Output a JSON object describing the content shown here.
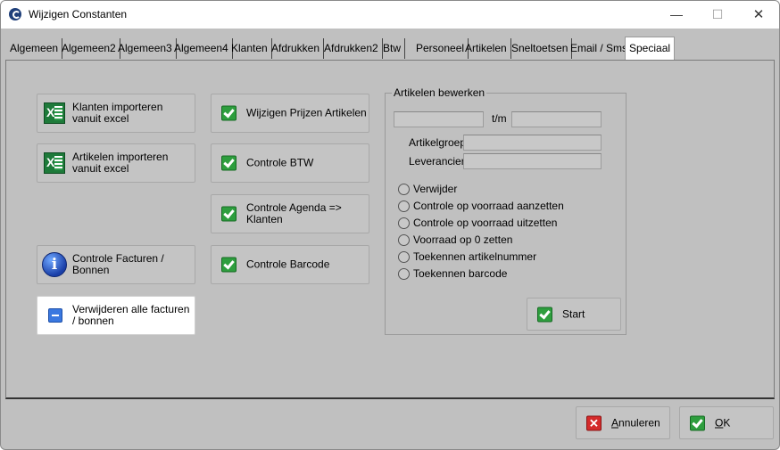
{
  "window": {
    "title": "Wijzigen Constanten"
  },
  "titlebar": {
    "minimize": "—",
    "maximize": "☐",
    "close": "✕"
  },
  "tabs": [
    {
      "label": "Algemeen"
    },
    {
      "label": "Algemeen2"
    },
    {
      "label": "Algemeen3"
    },
    {
      "label": "Algemeen4"
    },
    {
      "label": "Klanten"
    },
    {
      "label": "Afdrukken"
    },
    {
      "label": "Afdrukken2"
    },
    {
      "label": "Btw"
    },
    {
      "label": "Personeel"
    },
    {
      "label": "Artikelen"
    },
    {
      "label": "Sneltoetsen"
    },
    {
      "label": "Email / Sms"
    },
    {
      "label": "Speciaal"
    }
  ],
  "active_tab": "Speciaal",
  "left_buttons": {
    "import_klanten": "Klanten importeren vanuit excel",
    "import_artikelen": "Artikelen importeren vanuit excel",
    "controle_facturen": "Controle Facturen / Bonnen",
    "verwijderen_facturen": "Verwijderen alle facturen / bonnen"
  },
  "middle_buttons": {
    "wijzigen_prijzen": "Wijzigen Prijzen Artikelen",
    "controle_btw": "Controle BTW",
    "controle_agenda": "Controle Agenda => Klanten",
    "controle_barcode": "Controle Barcode"
  },
  "artikelen_bewerken": {
    "title": "Artikelen bewerken",
    "range_from": "",
    "range_sep": "t/m",
    "range_to": "",
    "artikelgroep_label": "Artikelgroep",
    "artikelgroep_value": "",
    "leverancier_label": "Leverancier",
    "leverancier_value": "",
    "options": [
      "Verwijder",
      "Controle op voorraad aanzetten",
      "Controle op voorraad uitzetten",
      "Voorraad op 0 zetten",
      "Toekennen artikelnummer",
      "Toekennen barcode"
    ],
    "start_label": "Start"
  },
  "footer": {
    "annuleren_rest": "nnuleren",
    "annuleren_mnemonic": "A",
    "ok_mnemonic": "O",
    "ok_rest": "K"
  },
  "colors": {
    "background": "#c0c0c0",
    "check_green": "#2e9e3e",
    "cancel_red": "#d42a2a",
    "info_blue": "#1a3fa8"
  }
}
